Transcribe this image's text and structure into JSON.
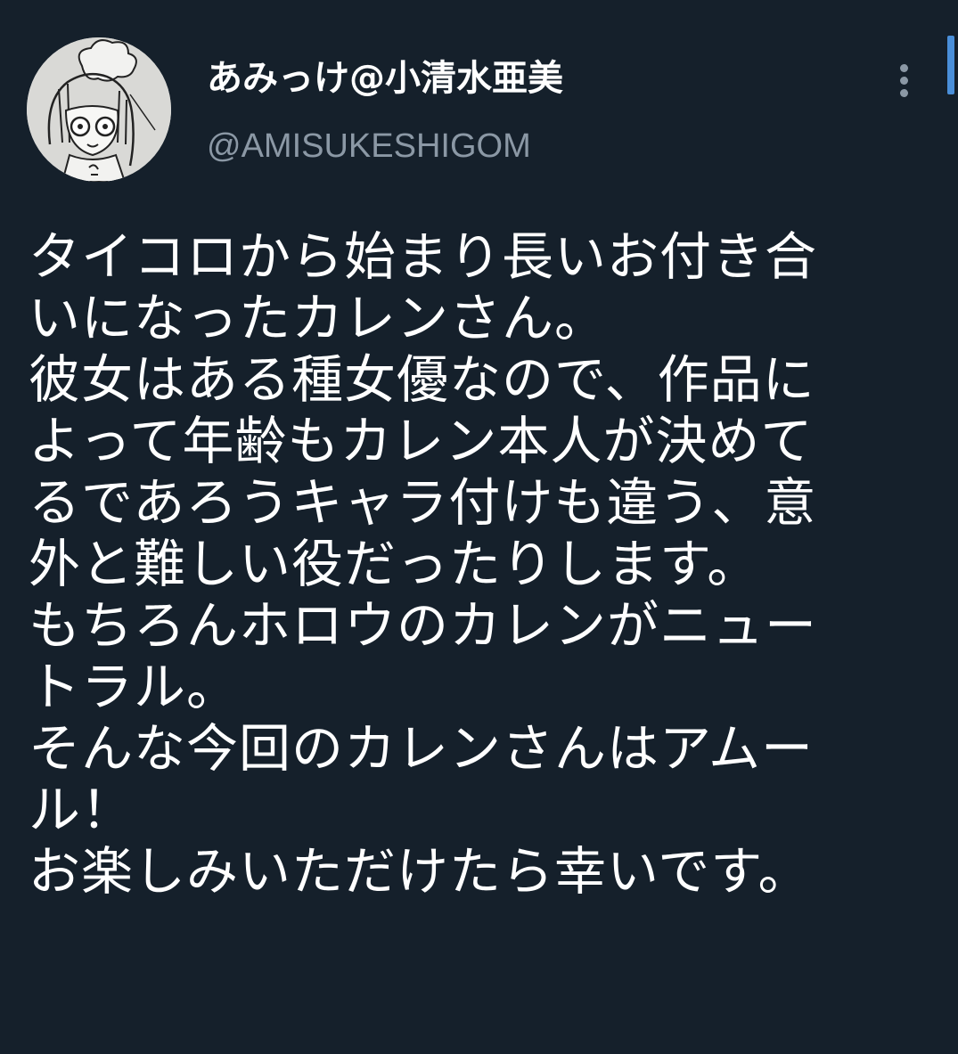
{
  "tweet": {
    "author": {
      "display_name": "あみっけ@小清水亜美",
      "handle": "@AMISUKESHIGOM",
      "avatar_icon": "avatar-drawing"
    },
    "more_icon": "more-vertical-icon",
    "lines": [
      "タイコロから始まり長いお付き合",
      "いになったカレンさん。",
      "彼女はある種女優なので、作品に",
      "よって年齢もカレン本人が決めて",
      "るであろうキャラ付けも違う、意",
      "外と難しい役だったりします。",
      "もちろんホロウのカレンがニュー",
      "トラル。",
      "そんな今回のカレンさんはアムー",
      "ル！",
      "お楽しみいただけたら幸いです。"
    ]
  },
  "colors": {
    "background": "#15202b",
    "text": "#ffffff",
    "secondary_text": "#8b98a5",
    "scroll_indicator": "#4a8fd9"
  }
}
